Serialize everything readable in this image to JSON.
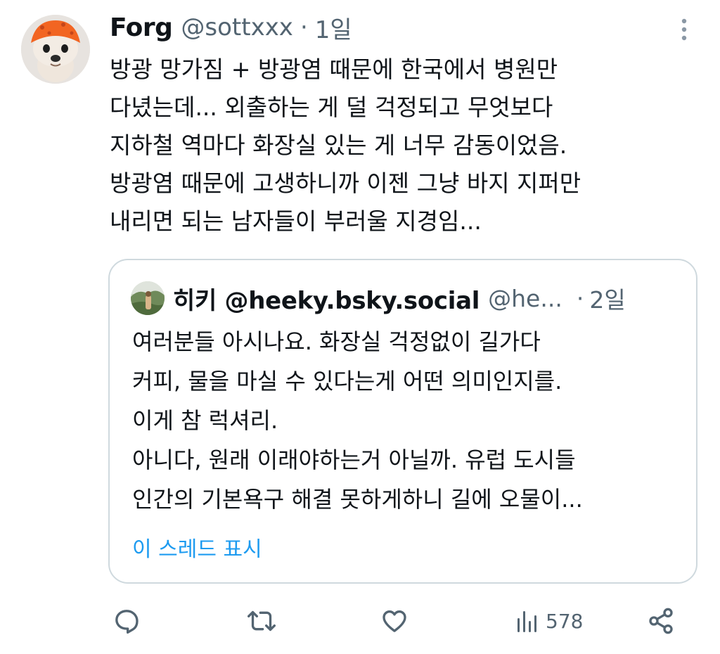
{
  "post": {
    "author_name": "Forg",
    "author_handle": "@sottxxx",
    "separator": "·",
    "time": "1일",
    "body_lines": [
      "방광 망가짐 + 방광염 때문에 한국에서 병원만",
      "다녔는데... 외출하는 게 덜 걱정되고 무엇보다",
      "지하철 역마다 화장실 있는 게 너무 감동이었음.",
      "방광염 때문에 고생하니까 이젠 그냥 바지 지퍼만",
      "내리면 되는 남자들이 부러울 지경임..."
    ],
    "icons": {
      "more": "more-vertical-icon"
    }
  },
  "quote": {
    "author_name": "히키 @heeky.bsky.social",
    "author_handle": "@he...",
    "separator": "·",
    "time": "2일",
    "body_lines": [
      "여러분들 아시나요. 화장실 걱정없이 길가다",
      "커피, 물을 마실 수 있다는게 어떤 의미인지를.",
      "이게 참 럭셔리.",
      "아니다, 원래 이래야하는거 아닐까. 유럽 도시들",
      "인간의 기본욕구 해결 못하게하니 길에 오물이..."
    ],
    "show_thread": "이 스레드 표시"
  },
  "actions": {
    "views_count": "578",
    "icons": [
      "reply-icon",
      "repost-icon",
      "like-icon",
      "views-icon",
      "share-icon"
    ]
  },
  "colors": {
    "text": "#0f1419",
    "secondary": "#536471",
    "link": "#1d9bf0",
    "border": "#cfd9de"
  }
}
